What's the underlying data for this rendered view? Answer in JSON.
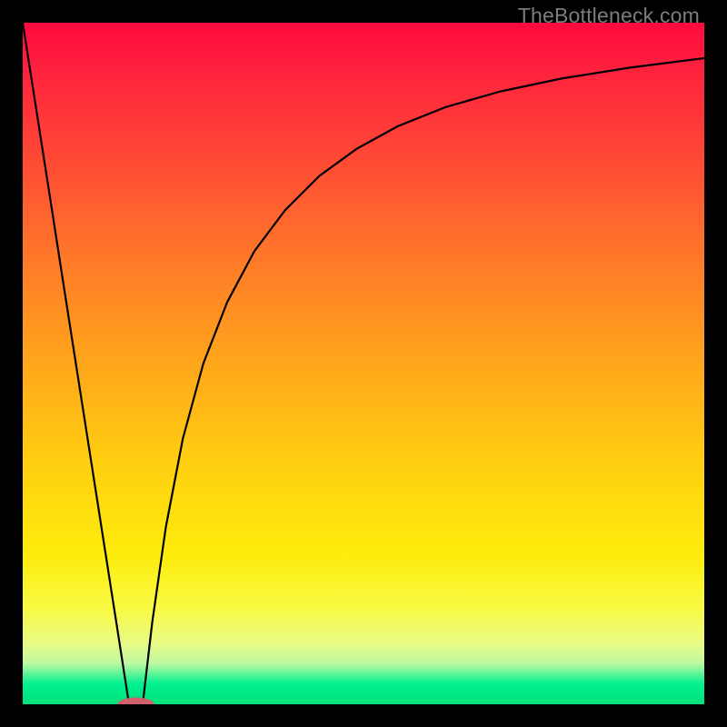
{
  "watermark": "TheBottleneck.com",
  "chart_data": {
    "type": "line",
    "title": "",
    "xlabel": "",
    "ylabel": "",
    "xlim": [
      0,
      1
    ],
    "ylim": [
      0,
      1
    ],
    "series": [
      {
        "name": "left-branch",
        "x": [
          0.0,
          0.02,
          0.04,
          0.06,
          0.08,
          0.1,
          0.12,
          0.14,
          0.156
        ],
        "y": [
          1.0,
          0.872,
          0.744,
          0.615,
          0.487,
          0.359,
          0.231,
          0.103,
          0.0
        ]
      },
      {
        "name": "right-branch",
        "x": [
          0.176,
          0.19,
          0.21,
          0.235,
          0.265,
          0.3,
          0.34,
          0.385,
          0.435,
          0.49,
          0.55,
          0.62,
          0.7,
          0.79,
          0.89,
          1.0
        ],
        "y": [
          0.0,
          0.12,
          0.26,
          0.39,
          0.5,
          0.59,
          0.665,
          0.725,
          0.775,
          0.815,
          0.848,
          0.876,
          0.899,
          0.918,
          0.934,
          0.948
        ]
      }
    ],
    "marker": {
      "name": "minimum-marker",
      "cx": 0.166,
      "cy": 0.0,
      "rx": 0.027,
      "ry": 0.01,
      "fill": "#d0606a"
    },
    "background_gradient_stops": [
      {
        "pos": 0.0,
        "color": "#ff0a3d"
      },
      {
        "pos": 0.5,
        "color": "#ffa61b"
      },
      {
        "pos": 0.85,
        "color": "#f9fa45"
      },
      {
        "pos": 1.0,
        "color": "#00e37c"
      }
    ]
  }
}
